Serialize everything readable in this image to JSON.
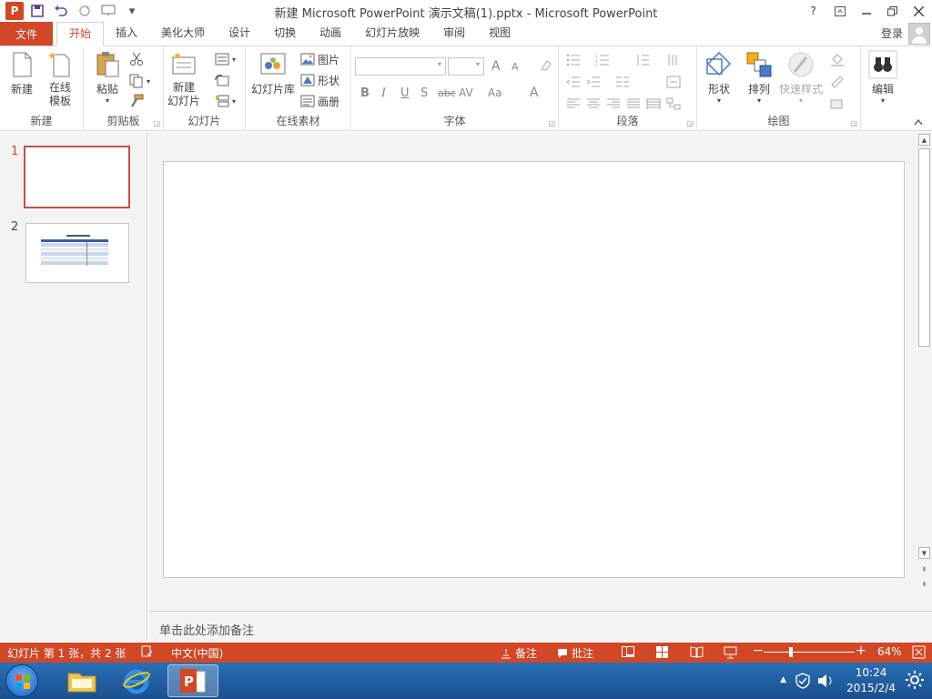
{
  "window": {
    "title": "新建 Microsoft PowerPoint 演示文稿(1).pptx - Microsoft PowerPoint",
    "app_letter": "P",
    "help": "?",
    "login": "登录"
  },
  "tabs": {
    "file": "文件",
    "items": [
      "开始",
      "插入",
      "美化大师",
      "设计",
      "切换",
      "动画",
      "幻灯片放映",
      "审阅",
      "视图"
    ]
  },
  "ribbon": {
    "new_group": {
      "label": "新建",
      "new": "新建",
      "online_template_1": "在线",
      "online_template_2": "模板"
    },
    "clipboard_group": {
      "label": "剪贴板",
      "paste": "粘贴"
    },
    "slides_group": {
      "label": "幻灯片",
      "new_slide_1": "新建",
      "new_slide_2": "幻灯片"
    },
    "online_group": {
      "label": "在线素材",
      "library": "幻灯片库",
      "picture": "图片",
      "shape": "形状",
      "album": "画册"
    },
    "font_group": {
      "label": "字体",
      "bold": "B",
      "italic": "I",
      "underline": "U",
      "shadow": "S",
      "strike": "abc",
      "spacing": "AV",
      "case": "Aa",
      "color": "A",
      "grow": "A",
      "shrink": "A"
    },
    "paragraph_group": {
      "label": "段落"
    },
    "drawing_group": {
      "label": "绘图",
      "shapes": "形状",
      "arrange": "排列",
      "quick_styles": "快速样式"
    },
    "editing_group": {
      "label": "编辑"
    }
  },
  "thumbnails": [
    {
      "number": "1",
      "selected": true
    },
    {
      "number": "2",
      "selected": false
    }
  ],
  "notes": {
    "placeholder": "单击此处添加备注"
  },
  "status": {
    "slide_info": "幻灯片 第 1 张，共 2 张",
    "language": "中文(中国)",
    "notes": "备注",
    "comments": "批注",
    "zoom": "64%",
    "zoom_fraction": 0.64
  },
  "taskbar": {
    "time": "10:24",
    "date": "2015/2/4"
  },
  "colors": {
    "accent": "#d24726",
    "selected_thumb": "#c0504d"
  }
}
